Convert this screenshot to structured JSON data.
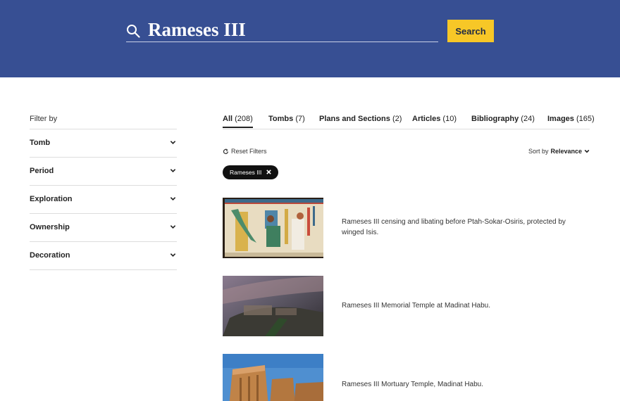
{
  "search": {
    "value": "Rameses III",
    "button_label": "Search"
  },
  "filters": {
    "heading": "Filter by",
    "items": [
      {
        "label": "Tomb"
      },
      {
        "label": "Period"
      },
      {
        "label": "Exploration"
      },
      {
        "label": "Ownership"
      },
      {
        "label": "Decoration"
      }
    ]
  },
  "tabs": [
    {
      "name": "All",
      "count": "(208)",
      "active": true
    },
    {
      "name": "Tombs",
      "count": "(7)"
    },
    {
      "name": "Plans and Sections",
      "count": "(2)"
    },
    {
      "name": "Articles",
      "count": "(10)"
    },
    {
      "name": "Bibliography",
      "count": "(24)"
    },
    {
      "name": "Images",
      "count": "(165)"
    }
  ],
  "controls": {
    "reset_label": "Reset Filters",
    "sort_prefix": "Sort by",
    "sort_value": "Relevance"
  },
  "active_filter": {
    "label": "Rameses III"
  },
  "results": [
    {
      "caption": "Rameses III censing and libating before Ptah-Sokar-Osiris, protected by winged Isis."
    },
    {
      "caption": "Rameses III Memorial Temple at Madinat Habu."
    },
    {
      "caption": "Rameses III Mortuary Temple, Madinat Habu."
    }
  ],
  "colors": {
    "header": "#374f93",
    "search_button": "#f7c727",
    "chip": "#111111"
  }
}
